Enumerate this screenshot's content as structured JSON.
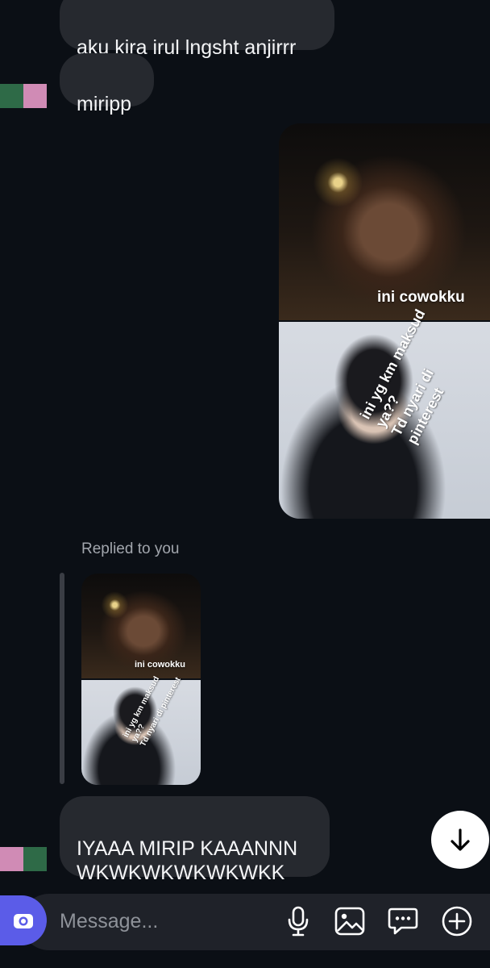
{
  "messages": {
    "received_1": "aku kira irul lngsht anjirrr",
    "received_2": "miripp",
    "sent_image_caption_top": "ini cowokku",
    "sent_image_caption_bottom": "ini yg km maksud ya??\nTd nyari di pinterest",
    "replied_label": "Replied to you",
    "reply_caption_top": "ini cowokku",
    "reply_caption_bottom": "ini yg km maksud ya??\nTd nyari di pinterest",
    "received_3": "IYAAA MIRIP KAAANNN\nWKWKWKWKWKWKK"
  },
  "composer": {
    "placeholder": "Message..."
  },
  "icons": {
    "scroll_down": "arrow-down-icon",
    "camera": "camera-icon",
    "microphone": "microphone-icon",
    "gallery": "image-icon",
    "sticker": "chat-bubble-icon",
    "plus": "plus-circle-icon"
  },
  "colors": {
    "background": "#0b0f15",
    "bubble": "#26292f",
    "accent": "#5b5ce8"
  }
}
